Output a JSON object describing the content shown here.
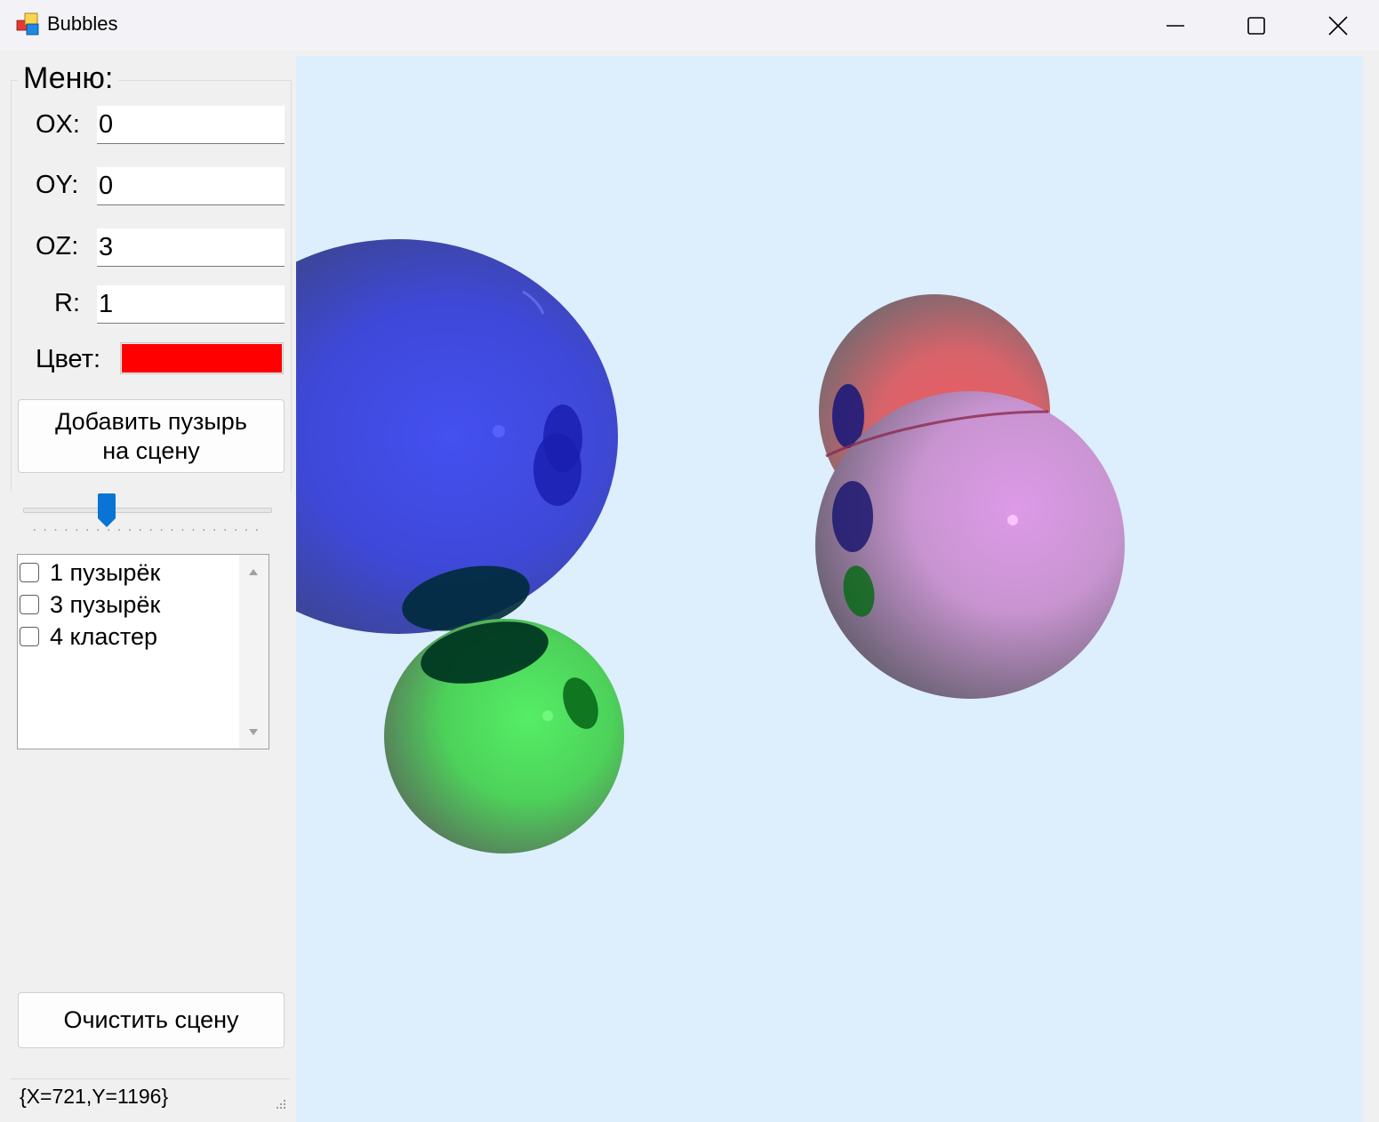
{
  "window": {
    "title": "Bubbles"
  },
  "menu": {
    "group_title": "Меню:",
    "ox_label": "OX:",
    "ox_value": "0",
    "oy_label": "OY:",
    "oy_value": "0",
    "oz_label": "OZ:",
    "oz_value": "3",
    "r_label": "R:",
    "r_value": "1",
    "color_label": "Цвет:",
    "color_value": "#ff0000",
    "add_button_line1": "Добавить пузырь",
    "add_button_line2": "на сцену",
    "slider_value": 0.32
  },
  "list": {
    "items": [
      {
        "label": "1 пузырёк",
        "checked": false
      },
      {
        "label": "3 пузырёк",
        "checked": false
      },
      {
        "label": "4 кластер",
        "checked": false
      }
    ]
  },
  "clear_button": "Очистить сцену",
  "status": {
    "coords": "{X=721,Y=1196}"
  },
  "scene": {
    "background": "#ddeefc",
    "bubbles": [
      {
        "name": "blue-bubble",
        "color": "#3a46e0"
      },
      {
        "name": "green-bubble",
        "color": "#4fe060"
      },
      {
        "name": "red-bubble",
        "color": "#e85a60"
      },
      {
        "name": "pink-bubble",
        "color": "#d595e0"
      }
    ]
  }
}
